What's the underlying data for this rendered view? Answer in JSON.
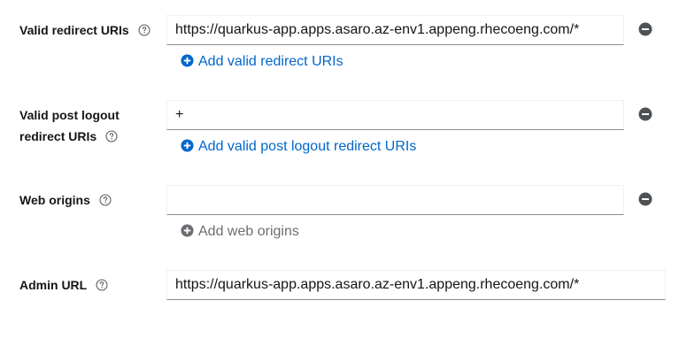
{
  "fields": {
    "valid_redirect_uris": {
      "label": "Valid redirect URIs",
      "value": "https://quarkus-app.apps.asaro.az-env1.appeng.rhecoeng.com/*",
      "add_label": "Add valid redirect URIs"
    },
    "valid_post_logout": {
      "label_line1": "Valid post logout",
      "label_line2": "redirect URIs",
      "value": "+",
      "add_label": "Add valid post logout redirect URIs"
    },
    "web_origins": {
      "label": "Web origins",
      "value": "",
      "add_label": "Add web origins"
    },
    "admin_url": {
      "label": "Admin URL",
      "value": "https://quarkus-app.apps.asaro.az-env1.appeng.rhecoeng.com/*"
    }
  },
  "colors": {
    "link": "#0066cc",
    "disabled": "#6a6e73",
    "remove_icon": "#4f5255",
    "help_icon": "#6a6e73"
  },
  "icons": {
    "help": "question-circle-icon",
    "remove": "minus-circle-icon",
    "add": "plus-circle-icon"
  }
}
